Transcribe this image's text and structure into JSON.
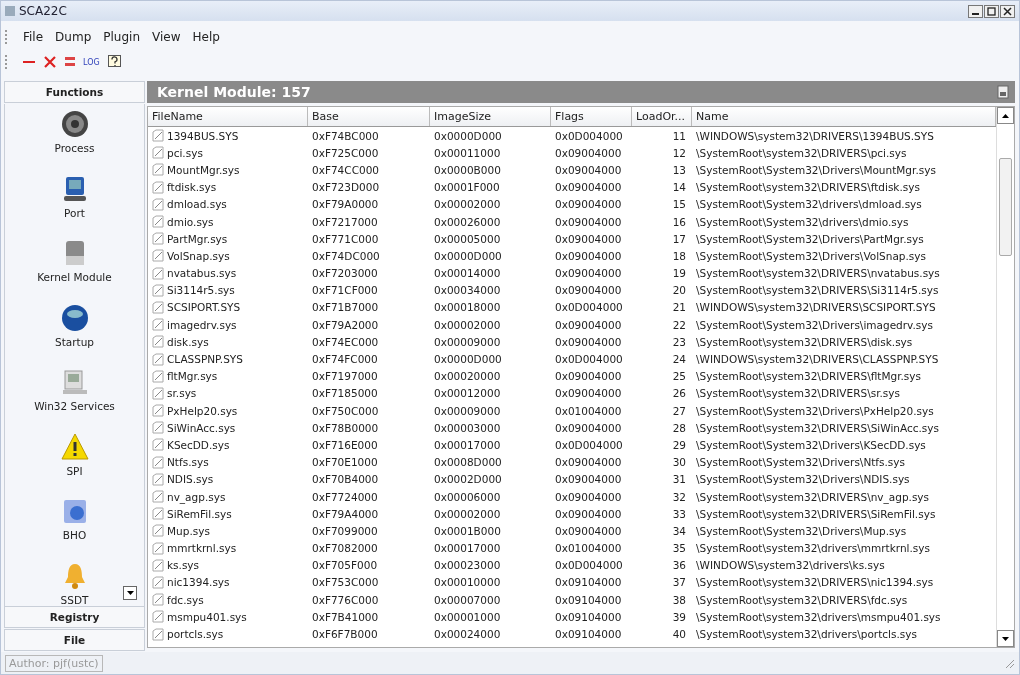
{
  "window": {
    "title": "SCA22C"
  },
  "menu": [
    "File",
    "Dump",
    "Plugin",
    "View",
    "Help"
  ],
  "toolbar": {
    "log_label": "LOG"
  },
  "sidebar": {
    "header": "Functions",
    "items": [
      {
        "label": "Process",
        "selected": false
      },
      {
        "label": "Port",
        "selected": false
      },
      {
        "label": "Kernel Module",
        "selected": false
      },
      {
        "label": "Startup",
        "selected": false
      },
      {
        "label": "Win32 Services",
        "selected": false
      },
      {
        "label": "SPI",
        "selected": false
      },
      {
        "label": "BHO",
        "selected": false
      },
      {
        "label": "SSDT",
        "selected": false
      }
    ],
    "sections": [
      "Registry",
      "File"
    ]
  },
  "panel": {
    "title": "Kernel Module:  157"
  },
  "table": {
    "columns": [
      "FileName",
      "Base",
      "ImageSize",
      "Flags",
      "LoadOr...",
      "Name"
    ],
    "rows": [
      [
        "1394BUS.SYS",
        "0xF74BC000",
        "0x0000D000",
        "0x0D004000",
        "11",
        "\\WINDOWS\\system32\\DRIVERS\\1394BUS.SYS"
      ],
      [
        "pci.sys",
        "0xF725C000",
        "0x00011000",
        "0x09004000",
        "12",
        "\\SystemRoot\\system32\\DRIVERS\\pci.sys"
      ],
      [
        "MountMgr.sys",
        "0xF74CC000",
        "0x0000B000",
        "0x09004000",
        "13",
        "\\SystemRoot\\System32\\Drivers\\MountMgr.sys"
      ],
      [
        "ftdisk.sys",
        "0xF723D000",
        "0x0001F000",
        "0x09004000",
        "14",
        "\\SystemRoot\\system32\\DRIVERS\\ftdisk.sys"
      ],
      [
        "dmload.sys",
        "0xF79A0000",
        "0x00002000",
        "0x09004000",
        "15",
        "\\SystemRoot\\System32\\drivers\\dmload.sys"
      ],
      [
        "dmio.sys",
        "0xF7217000",
        "0x00026000",
        "0x09004000",
        "16",
        "\\SystemRoot\\System32\\drivers\\dmio.sys"
      ],
      [
        "PartMgr.sys",
        "0xF771C000",
        "0x00005000",
        "0x09004000",
        "17",
        "\\SystemRoot\\System32\\Drivers\\PartMgr.sys"
      ],
      [
        "VolSnap.sys",
        "0xF74DC000",
        "0x0000D000",
        "0x09004000",
        "18",
        "\\SystemRoot\\System32\\Drivers\\VolSnap.sys"
      ],
      [
        "nvatabus.sys",
        "0xF7203000",
        "0x00014000",
        "0x09004000",
        "19",
        "\\SystemRoot\\system32\\DRIVERS\\nvatabus.sys"
      ],
      [
        "Si3114r5.sys",
        "0xF71CF000",
        "0x00034000",
        "0x09004000",
        "20",
        "\\SystemRoot\\system32\\DRIVERS\\Si3114r5.sys"
      ],
      [
        "SCSIPORT.SYS",
        "0xF71B7000",
        "0x00018000",
        "0x0D004000",
        "21",
        "\\WINDOWS\\system32\\DRIVERS\\SCSIPORT.SYS"
      ],
      [
        "imagedrv.sys",
        "0xF79A2000",
        "0x00002000",
        "0x09004000",
        "22",
        "\\SystemRoot\\System32\\Drivers\\imagedrv.sys"
      ],
      [
        "disk.sys",
        "0xF74EC000",
        "0x00009000",
        "0x09004000",
        "23",
        "\\SystemRoot\\system32\\DRIVERS\\disk.sys"
      ],
      [
        "CLASSPNP.SYS",
        "0xF74FC000",
        "0x0000D000",
        "0x0D004000",
        "24",
        "\\WINDOWS\\system32\\DRIVERS\\CLASSPNP.SYS"
      ],
      [
        "fltMgr.sys",
        "0xF7197000",
        "0x00020000",
        "0x09004000",
        "25",
        "\\SystemRoot\\system32\\DRIVERS\\fltMgr.sys"
      ],
      [
        "sr.sys",
        "0xF7185000",
        "0x00012000",
        "0x09004000",
        "26",
        "\\SystemRoot\\system32\\DRIVERS\\sr.sys"
      ],
      [
        "PxHelp20.sys",
        "0xF750C000",
        "0x00009000",
        "0x01004000",
        "27",
        "\\SystemRoot\\System32\\Drivers\\PxHelp20.sys"
      ],
      [
        "SiWinAcc.sys",
        "0xF78B0000",
        "0x00003000",
        "0x09004000",
        "28",
        "\\SystemRoot\\system32\\DRIVERS\\SiWinAcc.sys"
      ],
      [
        "KSecDD.sys",
        "0xF716E000",
        "0x00017000",
        "0x0D004000",
        "29",
        "\\SystemRoot\\System32\\Drivers\\KSecDD.sys"
      ],
      [
        "Ntfs.sys",
        "0xF70E1000",
        "0x0008D000",
        "0x09004000",
        "30",
        "\\SystemRoot\\System32\\Drivers\\Ntfs.sys"
      ],
      [
        "NDIS.sys",
        "0xF70B4000",
        "0x0002D000",
        "0x09004000",
        "31",
        "\\SystemRoot\\System32\\Drivers\\NDIS.sys"
      ],
      [
        "nv_agp.sys",
        "0xF7724000",
        "0x00006000",
        "0x09004000",
        "32",
        "\\SystemRoot\\system32\\DRIVERS\\nv_agp.sys"
      ],
      [
        "SiRemFil.sys",
        "0xF79A4000",
        "0x00002000",
        "0x09004000",
        "33",
        "\\SystemRoot\\system32\\DRIVERS\\SiRemFil.sys"
      ],
      [
        "Mup.sys",
        "0xF7099000",
        "0x0001B000",
        "0x09004000",
        "34",
        "\\SystemRoot\\System32\\Drivers\\Mup.sys"
      ],
      [
        "mmrtkrnl.sys",
        "0xF7082000",
        "0x00017000",
        "0x01004000",
        "35",
        "\\SystemRoot\\system32\\drivers\\mmrtkrnl.sys"
      ],
      [
        "ks.sys",
        "0xF705F000",
        "0x00023000",
        "0x0D004000",
        "36",
        "\\WINDOWS\\system32\\drivers\\ks.sys"
      ],
      [
        "nic1394.sys",
        "0xF753C000",
        "0x00010000",
        "0x09104000",
        "37",
        "\\SystemRoot\\system32\\DRIVERS\\nic1394.sys"
      ],
      [
        "fdc.sys",
        "0xF776C000",
        "0x00007000",
        "0x09104000",
        "38",
        "\\SystemRoot\\system32\\DRIVERS\\fdc.sys"
      ],
      [
        "msmpu401.sys",
        "0xF7B41000",
        "0x00001000",
        "0x09104000",
        "39",
        "\\SystemRoot\\system32\\drivers\\msmpu401.sys"
      ],
      [
        "portcls.sys",
        "0xF6F7B000",
        "0x00024000",
        "0x09104000",
        "40",
        "\\SystemRoot\\system32\\drivers\\portcls.sys"
      ]
    ]
  },
  "status_bar": {
    "author": "Author: pjf(ustc)"
  }
}
